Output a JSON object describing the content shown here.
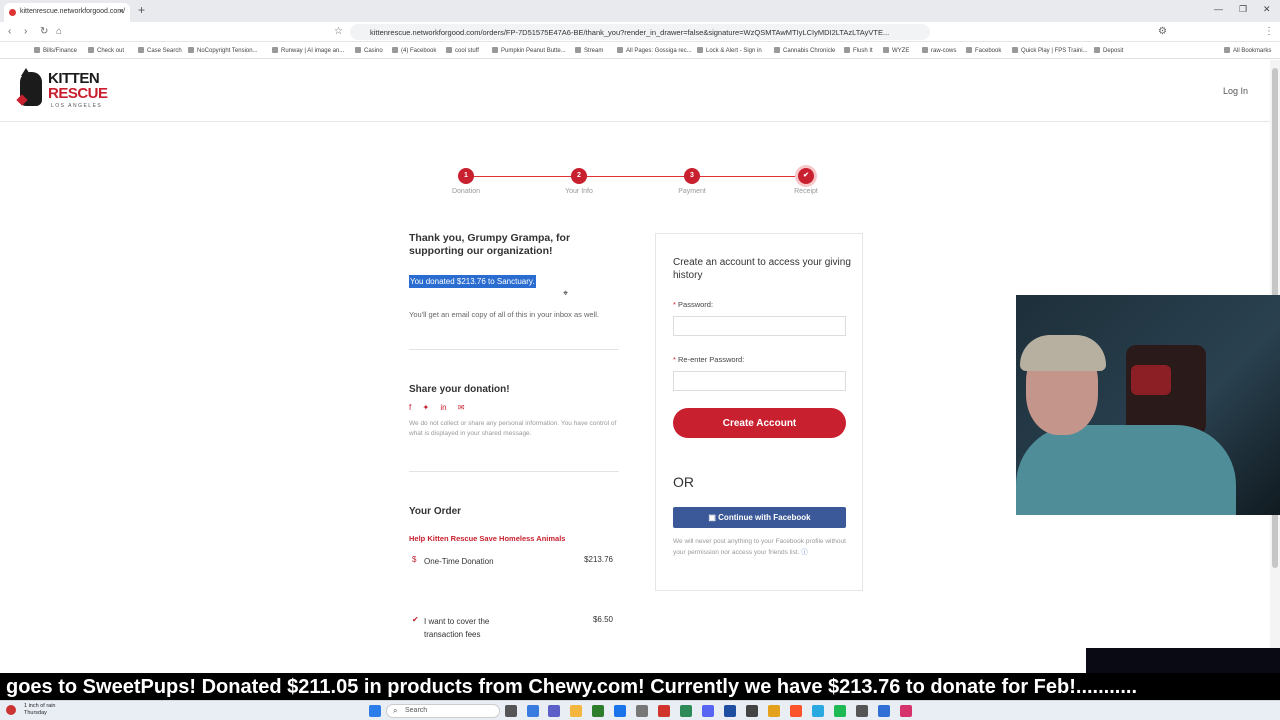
{
  "browser": {
    "tab_title": "kittenrescue.networkforgood.com/",
    "url": "kittenrescue.networkforgood.com/orders/FP-7D51575E47A6-BE/thank_you?render_in_drawer=false&signature=WzQSMTAwMTIyLCIyMDI2LTAzLTAyVTE...",
    "bookmarks": [
      "Bills/Finance",
      "Check out",
      "Case Search",
      "NoCopyright Tension...",
      "Runway | AI image an...",
      "Casino",
      "(4) Facebook",
      "cool stuff",
      "Pumpkin Peanut Butte...",
      "Stream",
      "All Pages: Gossiga rec...",
      "Lock & Alert - Sign in",
      "Cannabis Chronicle",
      "Flush It",
      "WYZE",
      "raw-cows",
      "Facebook",
      "Quick Play | FPS Traini...",
      "Deposit"
    ],
    "all_bookmarks": "All Bookmarks"
  },
  "header": {
    "logo_line1": "KITTEN",
    "logo_line2": "RESCUE",
    "logo_line3": "LOS ANGELES",
    "login": "Log In"
  },
  "steps": [
    {
      "num": "1",
      "label": "Donation"
    },
    {
      "num": "2",
      "label": "Your Info"
    },
    {
      "num": "3",
      "label": "Payment"
    },
    {
      "num": "✔",
      "label": "Receipt"
    }
  ],
  "receipt": {
    "thanks": "Thank you, Grumpy Grampa, for supporting our organization!",
    "donated": "You donated $213.76 to Sanctuary.",
    "email_copy": "You'll get an email copy of all of this in your inbox as well.",
    "share_title": "Share your donation!",
    "share_note": "We do not collect or share any personal information. You have control of what is displayed in your shared message.",
    "order_title": "Your Order",
    "order_item": "Help Kitten Rescue Save Homeless Animals",
    "lines": [
      {
        "icon": "$",
        "name": "One-Time Donation",
        "amount": "$213.76"
      },
      {
        "icon": "✔",
        "name": "I want to cover the transaction fees",
        "amount": "$6.50"
      }
    ]
  },
  "account": {
    "title": "Create an account to access your giving history",
    "password_label": "Password:",
    "reenter_label": "Re-enter Password:",
    "create_button": "Create Account",
    "or": "OR",
    "facebook_button": "Continue with Facebook",
    "facebook_note": "We will never post anything to your Facebook profile without your permission nor access your friends list."
  },
  "ticker": "goes to SweetPups! Donated $211.05 in products from Chewy.com! Currently we have $213.76 to donate for Feb!...........",
  "taskbar": {
    "weather_line1": "1 inch of rain",
    "weather_line2": "Thursday",
    "search_placeholder": "Search"
  },
  "colors": {
    "accent": "#c8202f",
    "facebook": "#3b5998",
    "highlight": "#2a6ccf"
  }
}
